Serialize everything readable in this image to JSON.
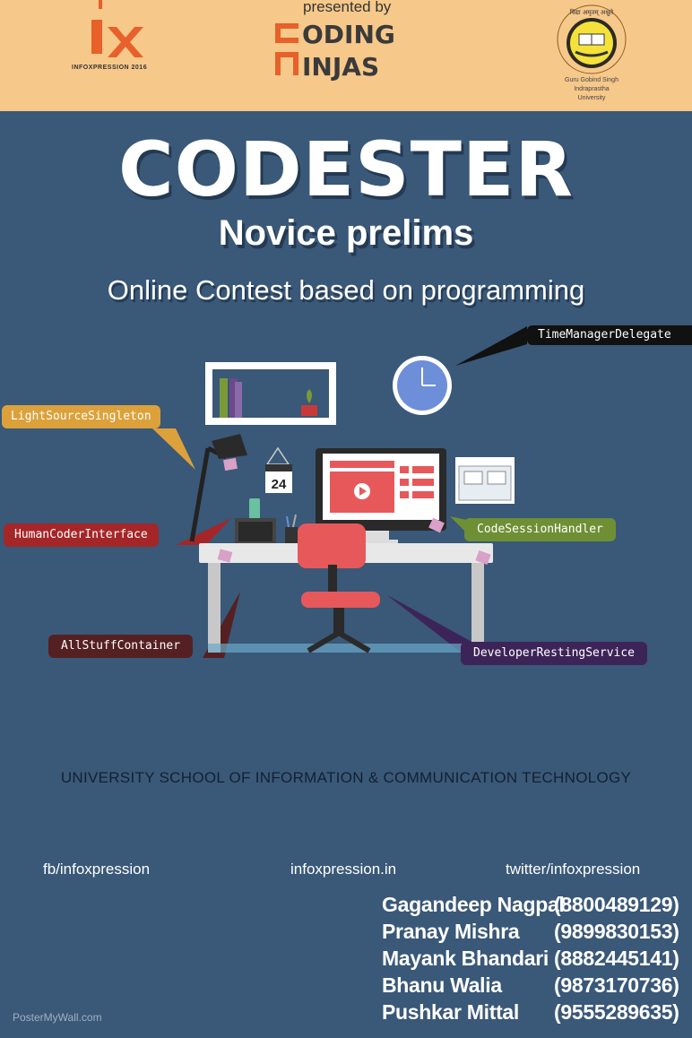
{
  "header": {
    "ix_logo_text": "INFOXPRESSION 2016",
    "presented_by": "presented by",
    "sponsor_logo": "CODING NINJAS",
    "university_lines": [
      "Guru Gobind Singh",
      "Indraprastha",
      "University"
    ],
    "seal_text": "विद्या अमृतम् अश्नुते"
  },
  "main": {
    "title": "CODESTER",
    "subtitle": "Novice prelims",
    "tagline": "Online Contest based on programming"
  },
  "illustration": {
    "calendar_day": "24",
    "callouts": {
      "time": "TimeManagerDelegate",
      "light": "LightSourceSingleton",
      "human": "HumanCoderInterface",
      "code": "CodeSessionHandler",
      "stuff": "AllStuffContainer",
      "dev": "DeveloperRestingService"
    },
    "icons": [
      "clock-icon",
      "lamp-icon",
      "monitor-icon",
      "play-icon",
      "chair-icon",
      "phone-icon",
      "calendar-icon",
      "shelf-frame",
      "plant-icon",
      "window-icon"
    ]
  },
  "footer": {
    "school": "UNIVERSITY SCHOOL OF INFORMATION & COMMUNICATION TECHNOLOGY",
    "links": {
      "fb": "fb/infoxpression",
      "site": "infoxpression.in",
      "twitter": "twitter/infoxpression"
    },
    "contacts": [
      {
        "name": "Gagandeep Nagpal",
        "phone": "(8800489129)"
      },
      {
        "name": "Pranay Mishra",
        "phone": "(9899830153)"
      },
      {
        "name": "Mayank Bhandari",
        "phone": "(8882445141)"
      },
      {
        "name": "Bhanu Walia",
        "phone": "(9873170736)"
      },
      {
        "name": "Pushkar Mittal",
        "phone": "(9555289635)"
      }
    ],
    "watermark": "PosterMyWall.com"
  },
  "colors": {
    "background": "#3a5878",
    "header": "#f6c88a",
    "logo_orange": "#e8602a",
    "callout_time": "#111111",
    "callout_light": "#dca13a",
    "callout_human": "#a52628",
    "callout_code": "#6e8f34",
    "callout_stuff": "#552022",
    "callout_dev": "#3d2458"
  }
}
